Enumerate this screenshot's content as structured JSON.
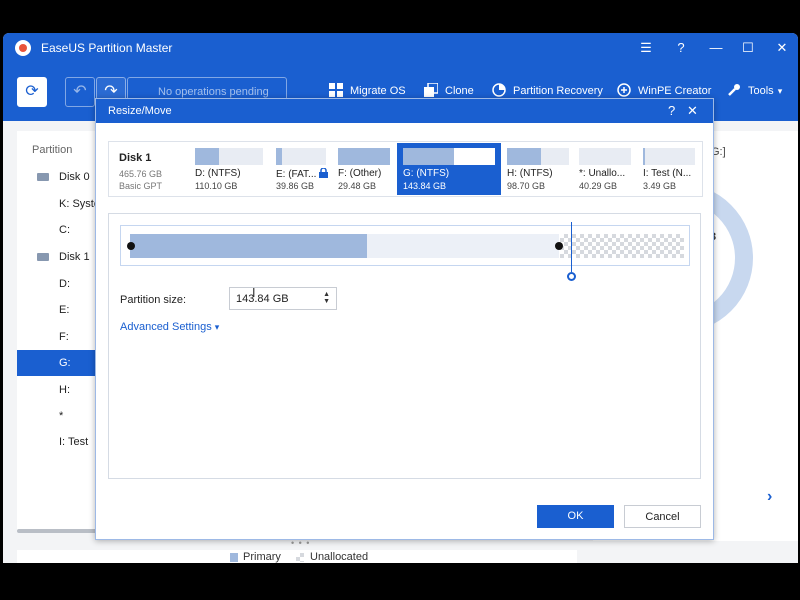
{
  "app": {
    "title": "EaseUS Partition Master",
    "controls": [
      "☰",
      "?",
      "—",
      "☐",
      "✕"
    ]
  },
  "toolbar": {
    "refresh_icon": "⟳",
    "undo_icon": "↶",
    "redo_icon": "↷",
    "operations_pending": "No operations pending",
    "items": [
      {
        "label": "Migrate OS",
        "icon": "migrate-os-icon"
      },
      {
        "label": "Clone",
        "icon": "clone-icon"
      },
      {
        "label": "Partition Recovery",
        "icon": "partition-recovery-icon"
      },
      {
        "label": "WinPE Creator",
        "icon": "winpe-creator-icon"
      },
      {
        "label": "Tools",
        "icon": "tools-icon"
      }
    ]
  },
  "sidebar": {
    "header": "Partition",
    "items": [
      {
        "label": "Disk 0",
        "type": "disk"
      },
      {
        "label": "K: System",
        "type": "partition"
      },
      {
        "label": "C:",
        "type": "partition"
      },
      {
        "label": "Disk 1",
        "type": "disk"
      },
      {
        "label": "D:",
        "type": "partition"
      },
      {
        "label": "E:",
        "type": "partition"
      },
      {
        "label": "F:",
        "type": "partition"
      },
      {
        "label": "G:",
        "type": "partition",
        "selected": true
      },
      {
        "label": "H:",
        "type": "partition"
      },
      {
        "label": "*",
        "type": "partition"
      },
      {
        "label": "I: Test",
        "type": "partition"
      }
    ]
  },
  "right_panel": {
    "partition_label": "G:]",
    "ring_value": "3",
    "next_icon": "›"
  },
  "legend": {
    "primary": "Primary",
    "unallocated": "Unallocated",
    "grip": "• • •"
  },
  "dialog": {
    "title": "Resize/Move",
    "help": "?",
    "close": "✕",
    "disk": {
      "name": "Disk 1",
      "size": "465.76 GB",
      "type": "Basic GPT"
    },
    "partitions": [
      {
        "name": "D: (NTFS)",
        "size": "110.10 GB",
        "used": 0.35
      },
      {
        "name": "E: (FAT...",
        "size": "39.86 GB",
        "used": 0.12,
        "locked": true
      },
      {
        "name": "F: (Other)",
        "size": "29.48 GB",
        "used": 1.0
      },
      {
        "name": "G: (NTFS)",
        "size": "143.84 GB",
        "used": 0.55,
        "selected": true
      },
      {
        "name": "H: (NTFS)",
        "size": "98.70 GB",
        "used": 0.55
      },
      {
        "name": "*: Unallo...",
        "size": "40.29 GB",
        "unallocated": true
      },
      {
        "name": "I: Test (N...",
        "size": "3.49 GB",
        "used": 0.04
      }
    ],
    "partition_size_label": "Partition size:",
    "partition_size_value": "143.84 GB",
    "advanced_settings": "Advanced Settings",
    "ok": "OK",
    "cancel": "Cancel"
  },
  "colors": {
    "accent": "#1a5fd0",
    "used": "#9fb8dd",
    "free": "#ecf0f7"
  }
}
